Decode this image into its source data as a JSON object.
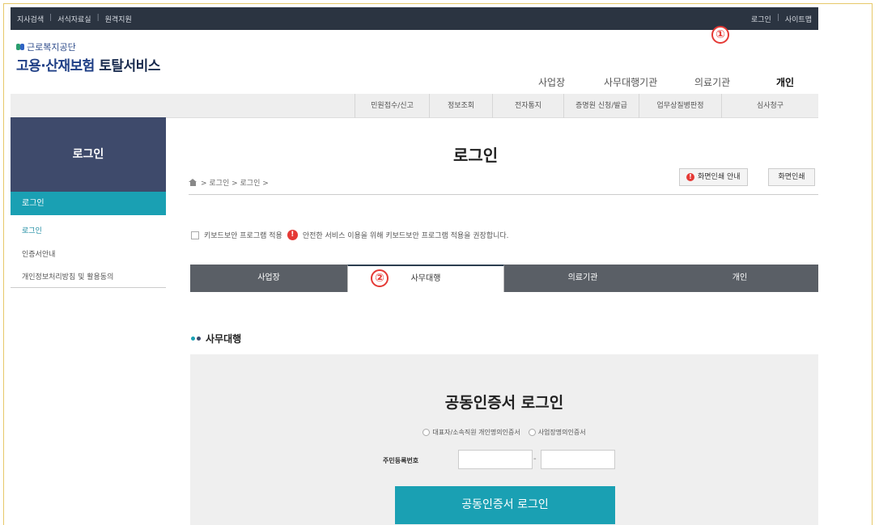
{
  "topbar": {
    "left_links": [
      "지사검색",
      "서식자료실",
      "원격지원"
    ],
    "right_links": [
      "로그인",
      "사이트맵"
    ],
    "separator": "|"
  },
  "logo": {
    "org": "근로복지공단",
    "service_main": "고용·산재보험",
    "service_sub": "토탈서비스"
  },
  "gnb": {
    "items": [
      "사업장",
      "사무대행기관",
      "의료기관",
      "개인"
    ],
    "active": "개인"
  },
  "annotations": {
    "marker1": "①",
    "marker2": "②"
  },
  "subnav": [
    "민원접수/신고",
    "정보조회",
    "전자통지",
    "증명원 신청/발급",
    "업무상질병판정",
    "심사청구"
  ],
  "sidebar": {
    "title": "로그인",
    "active_item": "로그인",
    "items": [
      "로그인",
      "인증서안내",
      "개인정보처리방침 및 활용동의"
    ]
  },
  "page": {
    "title": "로그인",
    "breadcrumb": "> 로그인 > 로그인 >",
    "guide_button": "화면인쇄 안내",
    "print_button": "화면인쇄",
    "warn_glyph": "!"
  },
  "keyboard": {
    "label": "키보드보안 프로그램 적용",
    "notice": "안전한 서비스 이용을 위해 키보드보안 프로그램 적용을 권장합니다."
  },
  "tabs": [
    "사업장",
    "사무대행",
    "의료기관",
    "개인"
  ],
  "active_tab": "사무대행",
  "section": {
    "title": "사무대행"
  },
  "login": {
    "title": "공동인증서 로그인",
    "radio1": "대표자/소속직원 개인명의인증서",
    "radio2": "사업장명의인증서",
    "id_label": "주민등록번호",
    "id_dash": "-",
    "button": "공동인증서 로그인"
  },
  "colors": {
    "topbar": "#2b3441",
    "side_head": "#3e4a6b",
    "accent": "#1aa0b3",
    "tab_dark": "#5a5f66",
    "marker": "#e53935"
  }
}
